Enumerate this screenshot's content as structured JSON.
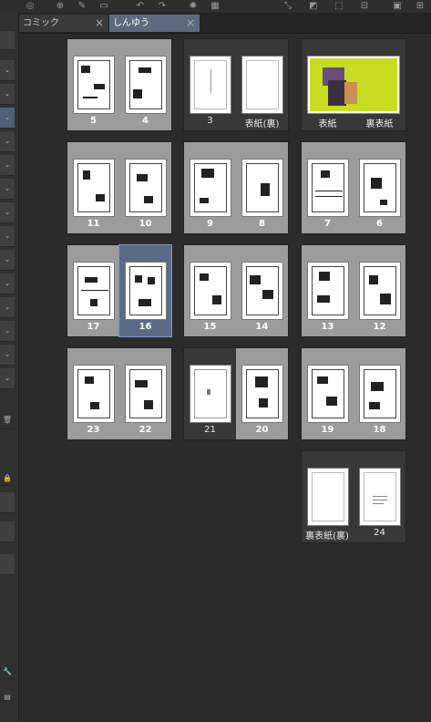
{
  "tabs": [
    {
      "label": "コミック",
      "close": "×",
      "active": false
    },
    {
      "label": "しんゆう",
      "close": "×",
      "active": true
    }
  ],
  "pages": {
    "p5": "5",
    "p4": "4",
    "p3": "3",
    "ura_hyoushi_back": "表紙(裏)",
    "hyoushi": "表紙",
    "ura_hyoushi": "裏表紙",
    "p11": "11",
    "p10": "10",
    "p9": "9",
    "p8": "8",
    "p7": "7",
    "p6": "6",
    "p17": "17",
    "p16": "16",
    "p15": "15",
    "p14": "14",
    "p13": "13",
    "p12": "12",
    "p23": "23",
    "p22": "22",
    "p21": "21",
    "p20": "20",
    "p19": "19",
    "p18": "18",
    "ura_ura": "裏表紙(裏)",
    "p24": "24"
  },
  "selected_page": "16",
  "colors": {
    "accent": "#5b6b87",
    "cover": "#c6dd22",
    "filled_page": "#9c9c9c"
  }
}
